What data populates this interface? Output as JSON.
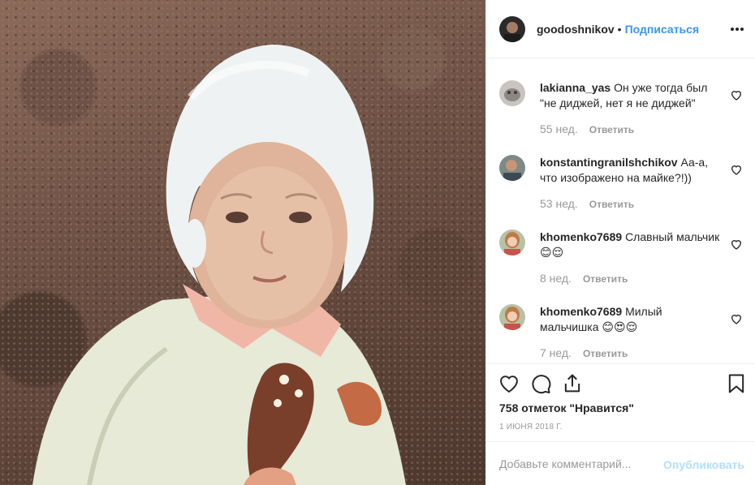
{
  "post": {
    "photo_alt": "",
    "author": {
      "username": "goodoshnikov",
      "separator": "•",
      "follow_label": "Подписаться",
      "more_icon": "more-horizontal-icon"
    },
    "comments": [
      {
        "username": "lakianna_yas",
        "text": "Он уже тогда был \"не диджей, нет я не диджей\"",
        "age": "55 нед.",
        "reply_label": "Ответить"
      },
      {
        "username": "konstantingranilshchikov",
        "text": "Аа-а, что изображено на майке?!))",
        "age": "53 нед.",
        "reply_label": "Ответить"
      },
      {
        "username": "khomenko7689",
        "text": "Славный мальчик 😊😌",
        "age": "8 нед.",
        "reply_label": "Ответить"
      },
      {
        "username": "khomenko7689",
        "text": "Милый мальчишка 😊😍😌",
        "age": "7 нед.",
        "reply_label": "Ответить"
      }
    ],
    "likes": "758 отметок \"Нравится\"",
    "date": "1 ИЮНЯ 2018 Г.",
    "add_comment": {
      "placeholder": "Добавьте комментарий...",
      "publish_label": "Опубликовать"
    },
    "colors": {
      "link_blue": "#3897f0",
      "publish_disabled": "#b2dffc",
      "muted": "#999999",
      "text": "#262626",
      "border": "#efefef"
    }
  }
}
